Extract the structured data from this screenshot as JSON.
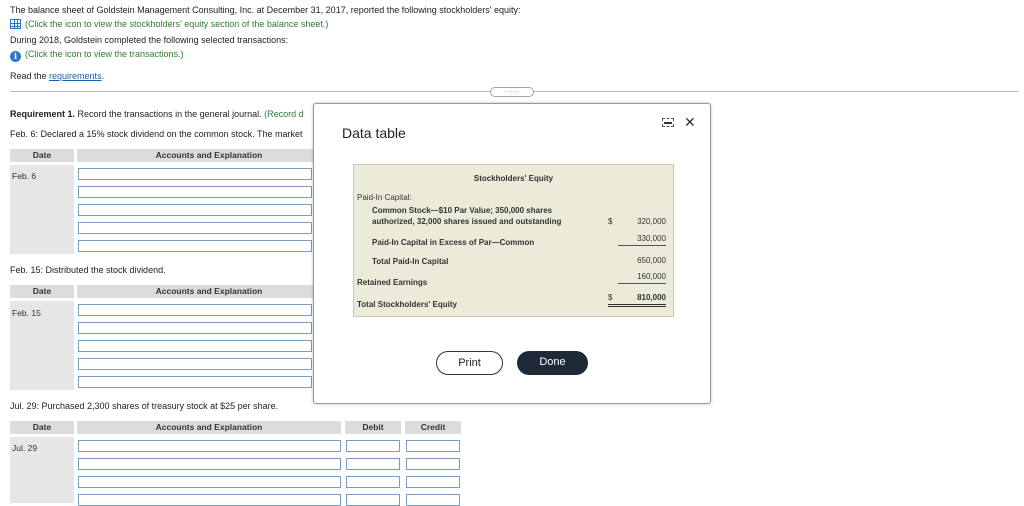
{
  "intro": {
    "line1": "The balance sheet of Goldstein Management Consulting, Inc. at December 31, 2017, reported the following stockholders' equity:",
    "equity_link": "(Click the icon to view the stockholders' equity section of the balance sheet.)",
    "line2": "During 2018, Goldstein completed the following selected transactions:",
    "txn_link": "(Click the icon to view the transactions.)",
    "read_prefix": "Read the ",
    "requirements_link": "requirements",
    "read_suffix": ".",
    "grip": "....."
  },
  "requirement": {
    "label": "Requirement 1.",
    "text": "Record the transactions in the general journal.",
    "hint": "(Record d",
    "feb6": "Feb. 6: Declared a 15% stock dividend on the common stock. The market",
    "feb15": "Feb. 15: Distributed the stock dividend.",
    "jul29": "Jul. 29: Purchased 2,300 shares of treasury stock at $25 per share."
  },
  "journal": {
    "col_date": "Date",
    "col_accounts": "Accounts and Explanation",
    "col_debit": "Debit",
    "col_credit": "Credit",
    "date1": "Feb. 6",
    "date2": "Feb. 15",
    "date3": "Jul. 29"
  },
  "data_table": {
    "title": "Data table",
    "table_title": "Stockholders' Equity",
    "paid_in_capital": "Paid-In Capital:",
    "common_stock_1": "Common Stock—$10 Par Value; 350,000 shares",
    "common_stock_2": "authorized, 32,000 shares issued and outstanding",
    "dollar1": "$",
    "common_value": "320,000",
    "apic_label": "Paid-In Capital in Excess of Par—Common",
    "apic_value": "330,000",
    "total_pic_label": "Total Paid-In Capital",
    "total_pic_value": "650,000",
    "retained_label": "Retained Earnings",
    "retained_value": "160,000",
    "total_se_label": "Total Stockholders' Equity",
    "dollar2": "$",
    "total_se_value": "810,000",
    "print_label": "Print",
    "done_label": "Done"
  }
}
